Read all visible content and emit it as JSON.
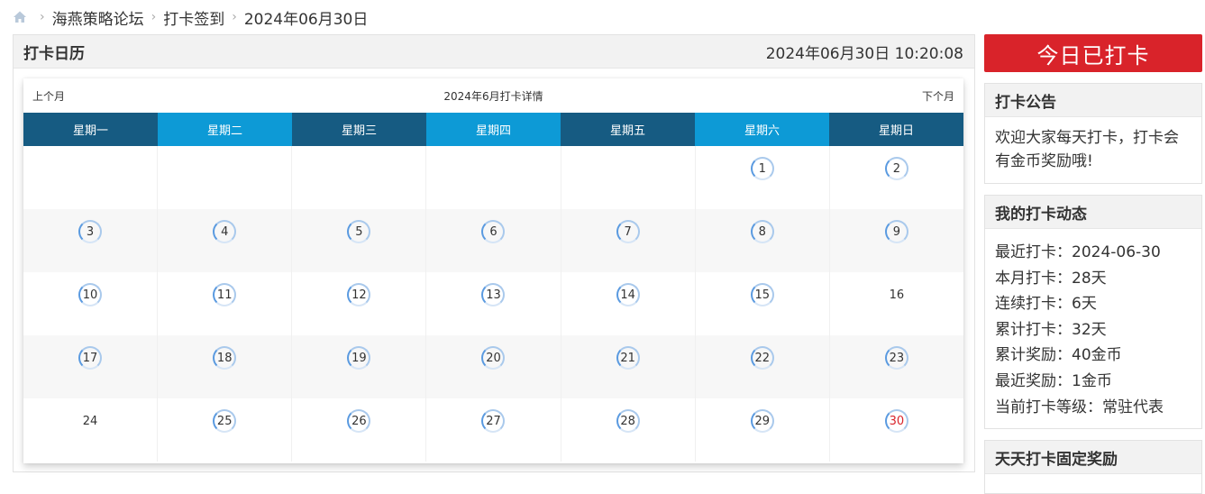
{
  "breadcrumb": {
    "items": [
      "海燕策略论坛",
      "打卡签到",
      "2024年06月30日"
    ]
  },
  "calendar_panel": {
    "title": "打卡日历",
    "datetime": "2024年06月30日 10:20:08",
    "prev_label": "上个月",
    "month_title": "2024年6月打卡详情",
    "next_label": "下个月",
    "weekdays": [
      "星期一",
      "星期二",
      "星期三",
      "星期四",
      "星期五",
      "星期六",
      "星期日"
    ],
    "weeks": [
      [
        {
          "d": ""
        },
        {
          "d": ""
        },
        {
          "d": ""
        },
        {
          "d": ""
        },
        {
          "d": ""
        },
        {
          "d": "1",
          "signed": true
        },
        {
          "d": "2",
          "signed": true
        }
      ],
      [
        {
          "d": "3",
          "signed": true
        },
        {
          "d": "4",
          "signed": true
        },
        {
          "d": "5",
          "signed": true
        },
        {
          "d": "6",
          "signed": true
        },
        {
          "d": "7",
          "signed": true
        },
        {
          "d": "8",
          "signed": true
        },
        {
          "d": "9",
          "signed": true
        }
      ],
      [
        {
          "d": "10",
          "signed": true
        },
        {
          "d": "11",
          "signed": true
        },
        {
          "d": "12",
          "signed": true
        },
        {
          "d": "13",
          "signed": true
        },
        {
          "d": "14",
          "signed": true
        },
        {
          "d": "15",
          "signed": true
        },
        {
          "d": "16",
          "signed": false
        }
      ],
      [
        {
          "d": "17",
          "signed": true
        },
        {
          "d": "18",
          "signed": true
        },
        {
          "d": "19",
          "signed": true
        },
        {
          "d": "20",
          "signed": true
        },
        {
          "d": "21",
          "signed": true
        },
        {
          "d": "22",
          "signed": true
        },
        {
          "d": "23",
          "signed": true
        }
      ],
      [
        {
          "d": "24",
          "signed": false
        },
        {
          "d": "25",
          "signed": true
        },
        {
          "d": "26",
          "signed": true
        },
        {
          "d": "27",
          "signed": true
        },
        {
          "d": "28",
          "signed": true
        },
        {
          "d": "29",
          "signed": true
        },
        {
          "d": "30",
          "signed": true,
          "today": true
        }
      ]
    ]
  },
  "sidebar": {
    "checkin_button": "今日已打卡",
    "notice": {
      "title": "打卡公告",
      "text": "欢迎大家每天打卡，打卡会有金币奖励哦!"
    },
    "stats": {
      "title": "我的打卡动态",
      "lines": [
        "最近打卡：2024-06-30",
        "本月打卡：28天",
        "连续打卡：6天",
        "累计打卡：32天",
        "累计奖励：40金币",
        "最近奖励：1金币",
        "当前打卡等级：常驻代表"
      ]
    },
    "reward": {
      "title": "天天打卡固定奖励"
    }
  },
  "colors": {
    "accent_red": "#d9232a",
    "weekday_dark": "#165b82",
    "weekday_light": "#0d9ad6",
    "today_text": "#d9232a"
  },
  "icons": {
    "home": "home-icon"
  }
}
